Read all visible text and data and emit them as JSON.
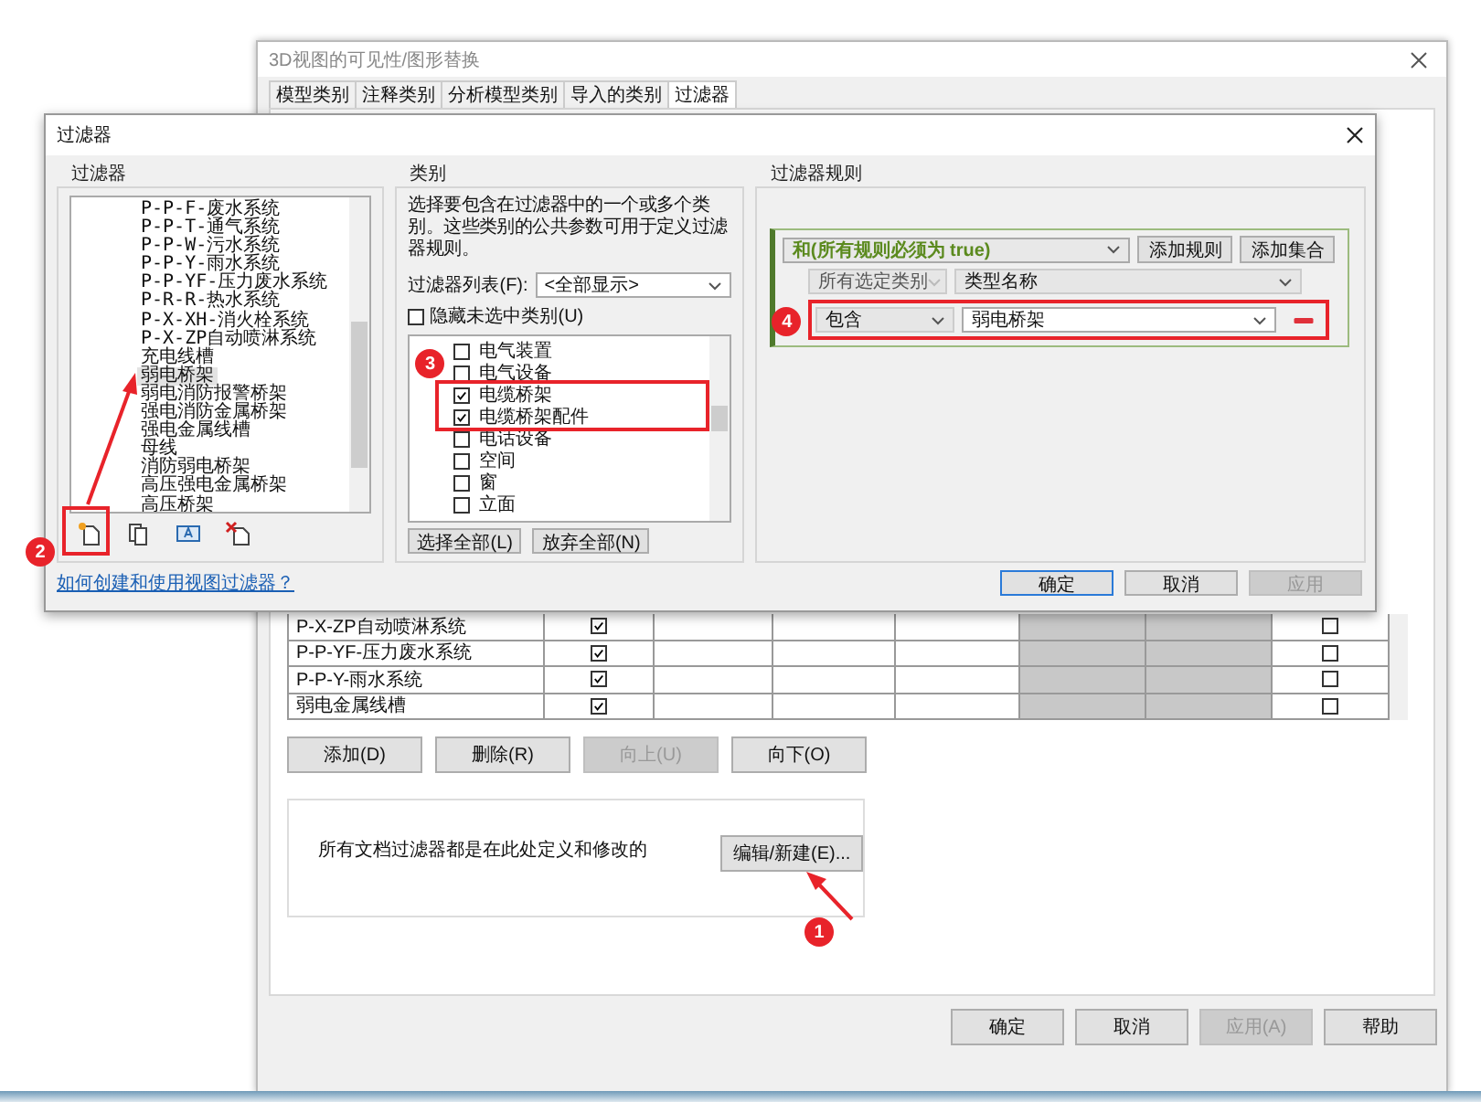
{
  "back_dialog": {
    "title": "3D视图的可见性/图形替换",
    "tabs": [
      {
        "label": "模型类别",
        "selected": false
      },
      {
        "label": "注释类别",
        "selected": false
      },
      {
        "label": "分析模型类别",
        "selected": false
      },
      {
        "label": "导入的类别",
        "selected": false
      },
      {
        "label": "过滤器",
        "selected": true
      }
    ],
    "table_rows": [
      {
        "name": "P-X-ZP自动喷淋系统",
        "visible": true,
        "halftone": false
      },
      {
        "name": "P-P-YF-压力废水系统",
        "visible": true,
        "halftone": false
      },
      {
        "name": "P-P-Y-雨水系统",
        "visible": true,
        "halftone": false
      },
      {
        "name": "弱电金属线槽",
        "visible": true,
        "halftone": false
      }
    ],
    "row_buttons": [
      {
        "label": "添加(D)",
        "disabled": false
      },
      {
        "label": "删除(R)",
        "disabled": false
      },
      {
        "label": "向上(U)",
        "disabled": true
      },
      {
        "label": "向下(O)",
        "disabled": false
      }
    ],
    "note": "所有文档过滤器都是在此处定义和修改的",
    "edit_button": "编辑/新建(E)...",
    "buttons": [
      {
        "label": "确定",
        "disabled": false
      },
      {
        "label": "取消",
        "disabled": false
      },
      {
        "label": "应用(A)",
        "disabled": true
      },
      {
        "label": "帮助",
        "disabled": false
      }
    ]
  },
  "filter_dialog": {
    "title": "过滤器",
    "filters": {
      "title": "过滤器",
      "items": [
        {
          "label": "P-P-F-废水系统",
          "selected": false
        },
        {
          "label": "P-P-T-通气系统",
          "selected": false
        },
        {
          "label": "P-P-W-污水系统",
          "selected": false
        },
        {
          "label": "P-P-Y-雨水系统",
          "selected": false
        },
        {
          "label": "P-P-YF-压力废水系统",
          "selected": false
        },
        {
          "label": "P-R-R-热水系统",
          "selected": false
        },
        {
          "label": "P-X-XH-消火栓系统",
          "selected": false
        },
        {
          "label": "P-X-ZP自动喷淋系统",
          "selected": false
        },
        {
          "label": "充电线槽",
          "selected": false
        },
        {
          "label": "弱电桥架",
          "selected": true
        },
        {
          "label": "弱电消防报警桥架",
          "selected": false
        },
        {
          "label": "强电消防金属桥架",
          "selected": false
        },
        {
          "label": "强电金属线槽",
          "selected": false
        },
        {
          "label": "母线",
          "selected": false
        },
        {
          "label": "消防弱电桥架",
          "selected": false
        },
        {
          "label": "高压强电金属桥架",
          "selected": false
        },
        {
          "label": "高压桥架",
          "selected": false
        }
      ],
      "help_link": "如何创建和使用视图过滤器？"
    },
    "categories": {
      "title": "类别",
      "description": "选择要包含在过滤器中的一个或多个类别。这些类别的公共参数可用于定义过滤器规则。",
      "list_label": "过滤器列表(F):",
      "list_value": "<全部显示>",
      "hide_unchecked": {
        "label": "隐藏未选中类别(U)",
        "checked": false
      },
      "items": [
        {
          "label": "电气装置",
          "checked": false
        },
        {
          "label": "电气设备",
          "checked": false
        },
        {
          "label": "电缆桥架",
          "checked": true
        },
        {
          "label": "电缆桥架配件",
          "checked": true
        },
        {
          "label": "电话设备",
          "checked": false
        },
        {
          "label": "空间",
          "checked": false
        },
        {
          "label": "窗",
          "checked": false
        },
        {
          "label": "立面",
          "checked": false
        }
      ],
      "buttons": [
        "选择全部(L)",
        "放弃全部(N)"
      ]
    },
    "rules": {
      "title": "过滤器规则",
      "logic": "和(所有规则必须为 true)",
      "buttons": [
        "添加规则",
        "添加集合"
      ],
      "category": "所有选定类别",
      "parameter": "类型名称",
      "operator": "包含",
      "value": "弱电桥架"
    },
    "buttons": [
      {
        "label": "确定",
        "kind": "default",
        "disabled": false
      },
      {
        "label": "取消",
        "kind": "normal",
        "disabled": false
      },
      {
        "label": "应用",
        "kind": "normal",
        "disabled": true
      }
    ]
  },
  "annotations": [
    {
      "number": "1"
    },
    {
      "number": "2"
    },
    {
      "number": "3"
    },
    {
      "number": "4"
    }
  ]
}
